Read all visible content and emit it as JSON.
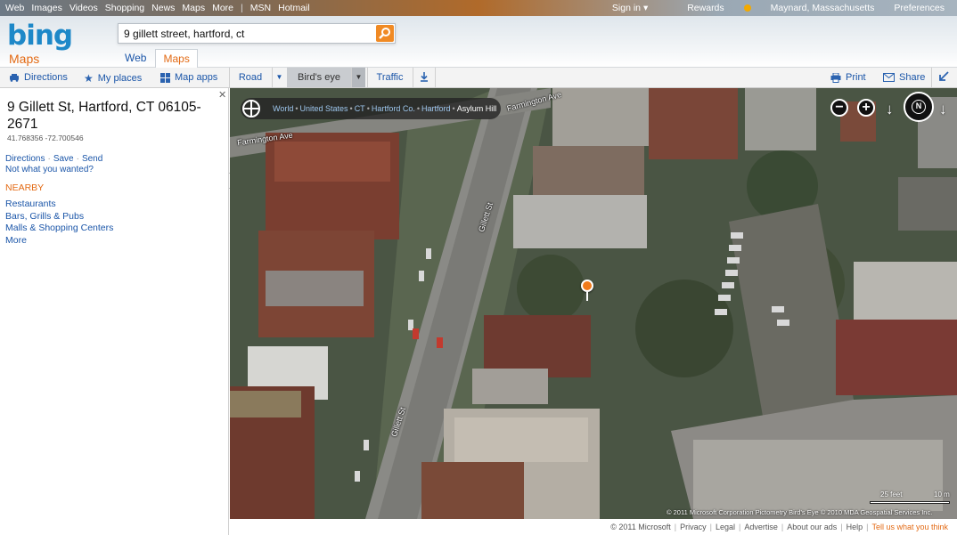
{
  "topbar": {
    "links": [
      "Web",
      "Images",
      "Videos",
      "Shopping",
      "News",
      "Maps",
      "More"
    ],
    "links2": [
      "MSN",
      "Hotmail"
    ],
    "sign_in": "Sign in ▾",
    "rewards": "Rewards",
    "location": "Maynard, Massachusetts",
    "preferences": "Preferences"
  },
  "header": {
    "logo": "bing",
    "product": "Maps",
    "search_value": "9 gillett street, hartford, ct",
    "tabs": [
      "Web",
      "Maps"
    ],
    "active_tab": "Maps"
  },
  "toolbar": {
    "directions": "Directions",
    "my_places": "My places",
    "map_apps": "Map apps",
    "road": "Road",
    "birds_eye": "Bird's eye",
    "traffic": "Traffic",
    "print": "Print",
    "share": "Share"
  },
  "panel": {
    "title": "9 Gillett St, Hartford, CT 06105-2671",
    "coords": "41.768356 -72.700546",
    "actions": [
      "Directions",
      "Save",
      "Send"
    ],
    "not_wanted": "Not what you wanted?",
    "nearby_label": "NEARBY",
    "nearby": [
      "Restaurants",
      "Bars, Grills & Pubs",
      "Malls & Shopping Centers",
      "More"
    ]
  },
  "map": {
    "breadcrumb": [
      "World",
      "United States",
      "CT",
      "Hartford Co.",
      "Hartford"
    ],
    "breadcrumb_current": "Asylum Hill",
    "streets": {
      "farmington_top": "Farmington Ave",
      "farmington_left": "Farmington Ave",
      "gillett_top": "Gillett St",
      "gillett_bottom": "Gillett St"
    },
    "scale_feet": "25 feet",
    "scale_m": "10 m",
    "attribution": "© 2011 Microsoft Corporation  Pictometry Bird's Eye © 2010 MDA Geospatial Services Inc.",
    "compass_label": "N"
  },
  "footer": {
    "copyright": "© 2011 Microsoft",
    "links": [
      "Privacy",
      "Legal",
      "Advertise",
      "About our ads",
      "Help"
    ],
    "tell_us": "Tell us what you think"
  }
}
